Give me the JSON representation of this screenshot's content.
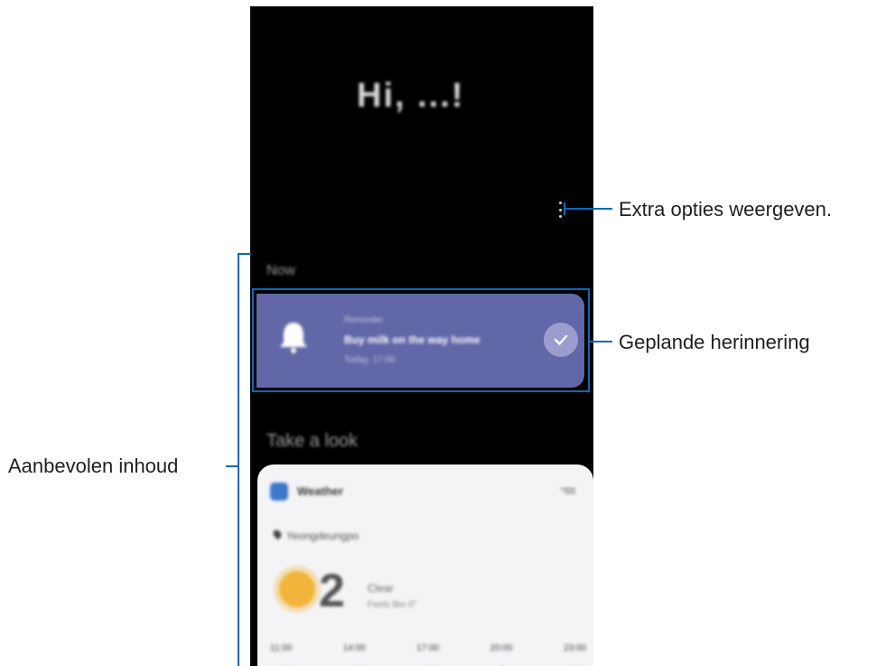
{
  "screen": {
    "greeting": "Hi, ...!",
    "section_now": "Now",
    "reminder": {
      "category": "Reminder",
      "title": "Buy milk on the way home",
      "time": "Today, 17:00"
    },
    "section_take_a_look": "Take a look",
    "weather": {
      "name": "Weather",
      "location": "Yeongdeungpo",
      "temperature": "2",
      "condition": "Clear",
      "feels_like": "Feels like 0°",
      "hours": [
        "11:00",
        "14:00",
        "17:00",
        "20:00",
        "23:00"
      ]
    }
  },
  "callouts": {
    "options": "Extra opties weergeven.",
    "reminder": "Geplande herinnering",
    "recommended": "Aanbevolen inhoud"
  },
  "colors": {
    "reminder_card": "#6267a7",
    "callout_line": "#0a6ab5",
    "sun": "#f2b43a"
  }
}
